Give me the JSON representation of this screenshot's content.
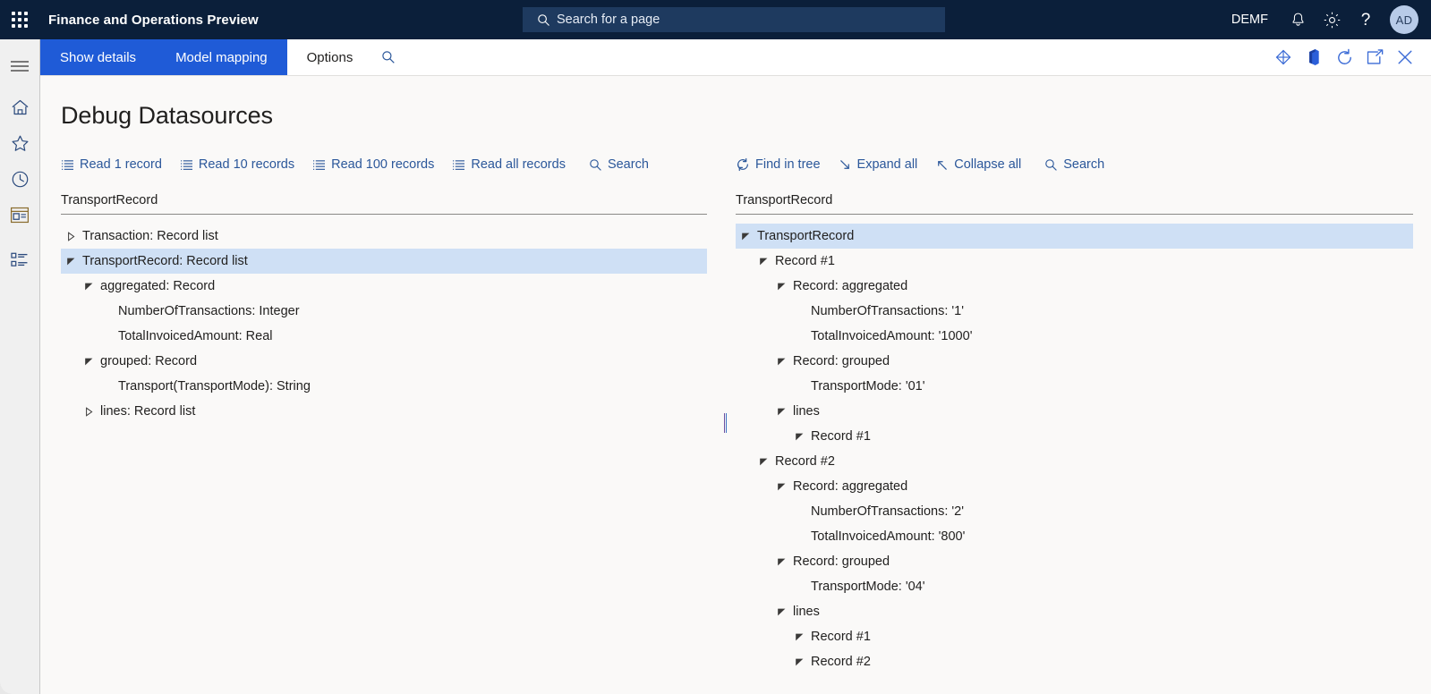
{
  "topbar": {
    "app_title": "Finance and Operations Preview",
    "waffle_icon": "app-launcher-icon",
    "search": {
      "placeholder": "Search for a page",
      "icon": "search-icon"
    },
    "company_id": "DEMF",
    "icons": [
      "notification-bell-icon",
      "settings-gear-icon",
      "help-question-icon"
    ],
    "avatar_initials": "AD"
  },
  "rail": {
    "items": [
      {
        "icon": "hamburger-menu-icon",
        "name": "navigation-menu"
      },
      {
        "icon": "home-icon",
        "name": "home"
      },
      {
        "icon": "star-icon",
        "name": "favorites"
      },
      {
        "icon": "clock-icon",
        "name": "recent"
      },
      {
        "icon": "workspace-icon",
        "name": "workspaces"
      },
      {
        "icon": "modules-list-icon",
        "name": "modules"
      }
    ]
  },
  "commandbar": {
    "tabs": [
      {
        "label": "Show details",
        "active": false
      },
      {
        "label": "Model mapping",
        "active": false
      },
      {
        "label": "Options",
        "active": true
      }
    ],
    "search_icon": "search-icon",
    "right_icons": [
      {
        "icon": "power-bi-diamond-icon",
        "name": "open-in-power-bi"
      },
      {
        "icon": "office-open-icon",
        "name": "open-in-office"
      },
      {
        "icon": "refresh-circle-icon",
        "name": "refresh"
      },
      {
        "icon": "popout-window-icon",
        "name": "open-in-new-window"
      },
      {
        "icon": "close-x-icon",
        "name": "close"
      }
    ]
  },
  "page": {
    "title": "Debug Datasources"
  },
  "left_panel": {
    "toolbar": [
      {
        "label": "Read 1 record",
        "icon": "list-lines-icon"
      },
      {
        "label": "Read 10 records",
        "icon": "list-lines-icon"
      },
      {
        "label": "Read 100 records",
        "icon": "list-lines-icon"
      },
      {
        "label": "Read all records",
        "icon": "list-lines-icon"
      },
      {
        "label": "Search",
        "icon": "search-icon"
      }
    ],
    "header": "TransportRecord",
    "tree": [
      {
        "label": "Transaction: Record list",
        "indent": 0,
        "state": "collapsed",
        "selected": false
      },
      {
        "label": "TransportRecord: Record list",
        "indent": 0,
        "state": "expanded",
        "selected": true
      },
      {
        "label": "aggregated: Record",
        "indent": 1,
        "state": "expanded",
        "selected": false
      },
      {
        "label": "NumberOfTransactions: Integer",
        "indent": 2,
        "state": "leaf",
        "selected": false
      },
      {
        "label": "TotalInvoicedAmount: Real",
        "indent": 2,
        "state": "leaf",
        "selected": false
      },
      {
        "label": "grouped: Record",
        "indent": 1,
        "state": "expanded",
        "selected": false
      },
      {
        "label": "Transport(TransportMode): String",
        "indent": 2,
        "state": "leaf",
        "selected": false
      },
      {
        "label": "lines: Record list",
        "indent": 1,
        "state": "collapsed",
        "selected": false
      }
    ]
  },
  "right_panel": {
    "toolbar": [
      {
        "label": "Find in tree",
        "icon": "refresh-circle-icon"
      },
      {
        "label": "Expand all",
        "icon": "arrow-down-right-icon"
      },
      {
        "label": "Collapse all",
        "icon": "arrow-up-left-icon"
      },
      {
        "label": "Search",
        "icon": "search-icon"
      }
    ],
    "header": "TransportRecord",
    "tree": [
      {
        "label": "TransportRecord",
        "indent": 0,
        "state": "expanded",
        "selected": true
      },
      {
        "label": "Record #1",
        "indent": 1,
        "state": "expanded",
        "selected": false
      },
      {
        "label": "Record: aggregated",
        "indent": 2,
        "state": "expanded",
        "selected": false
      },
      {
        "label": "NumberOfTransactions: '1'",
        "indent": 3,
        "state": "leaf",
        "selected": false
      },
      {
        "label": "TotalInvoicedAmount: '1000'",
        "indent": 3,
        "state": "leaf",
        "selected": false
      },
      {
        "label": "Record: grouped",
        "indent": 2,
        "state": "expanded",
        "selected": false
      },
      {
        "label": "TransportMode: '01'",
        "indent": 3,
        "state": "leaf",
        "selected": false
      },
      {
        "label": "lines",
        "indent": 2,
        "state": "expanded",
        "selected": false
      },
      {
        "label": "Record #1",
        "indent": 3,
        "state": "expanded",
        "selected": false
      },
      {
        "label": "Record #2",
        "indent": 1,
        "state": "expanded",
        "selected": false
      },
      {
        "label": "Record: aggregated",
        "indent": 2,
        "state": "expanded",
        "selected": false
      },
      {
        "label": "NumberOfTransactions: '2'",
        "indent": 3,
        "state": "leaf",
        "selected": false
      },
      {
        "label": "TotalInvoicedAmount: '800'",
        "indent": 3,
        "state": "leaf",
        "selected": false
      },
      {
        "label": "Record: grouped",
        "indent": 2,
        "state": "expanded",
        "selected": false
      },
      {
        "label": "TransportMode: '04'",
        "indent": 3,
        "state": "leaf",
        "selected": false
      },
      {
        "label": "lines",
        "indent": 2,
        "state": "expanded",
        "selected": false
      },
      {
        "label": "Record #1",
        "indent": 3,
        "state": "expanded",
        "selected": false
      },
      {
        "label": "Record #2",
        "indent": 3,
        "state": "expanded",
        "selected": false
      }
    ]
  },
  "colors": {
    "topbar_bg": "#0b1f3a",
    "tab_active_bg": "#1f5bd7",
    "link_blue": "#2b579a",
    "selection_bg": "#cfe0f5",
    "page_bg": "#faf9f8",
    "icon_blue": "#3b6bd6"
  }
}
